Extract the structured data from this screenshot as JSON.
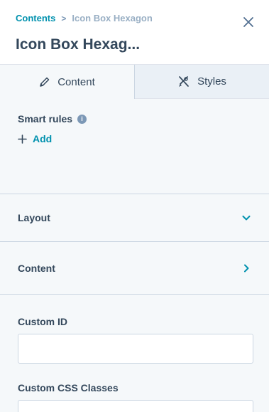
{
  "header": {
    "breadcrumb_link": "Contents",
    "breadcrumb_separator": ">",
    "breadcrumb_current": "Icon Box Hexagon",
    "title": "Icon Box Hexag..."
  },
  "tabs": [
    {
      "label": "Content",
      "icon": "pencil-icon",
      "active": true
    },
    {
      "label": "Styles",
      "icon": "styles-icon",
      "active": false
    }
  ],
  "smart_rules": {
    "label": "Smart rules",
    "info_glyph": "i",
    "add_label": "Add"
  },
  "sections": [
    {
      "label": "Layout",
      "state": "expanded"
    },
    {
      "label": "Content",
      "state": "collapsed"
    }
  ],
  "fields": {
    "custom_id": {
      "label": "Custom ID",
      "value": ""
    },
    "custom_css": {
      "label": "Custom CSS Classes",
      "value": ""
    }
  },
  "colors": {
    "accent": "#0091ae",
    "text": "#33475b",
    "panel_bg": "#f5f8fa",
    "inactive_tab_bg": "#eaf0f6",
    "border": "#cbd6e2"
  }
}
